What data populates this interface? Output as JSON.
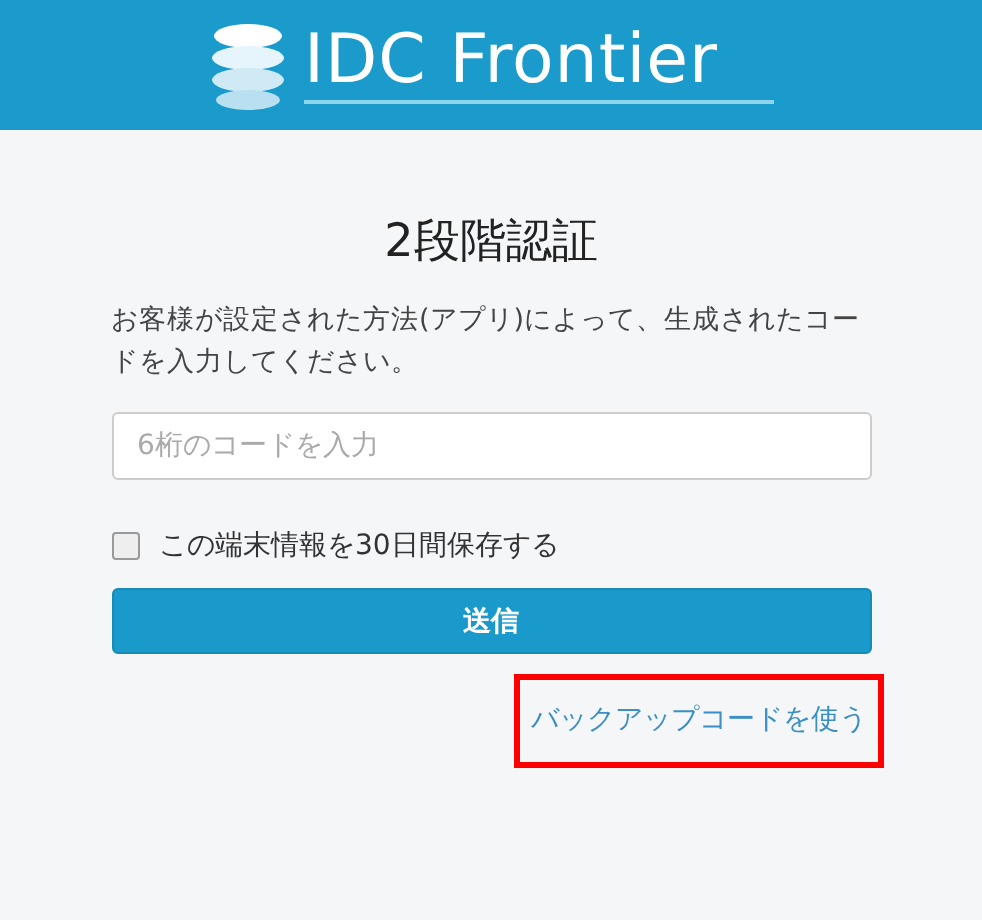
{
  "header": {
    "logo_text": "IDC Frontier"
  },
  "title": "2段階認証",
  "instructions": "お客様が設定された方法(アプリ)によって、生成されたコードを入力してください。",
  "code_field": {
    "placeholder": "6桁のコードを入力"
  },
  "remember_device": {
    "label": "この端末情報を30日間保存する",
    "checked": false
  },
  "submit_button": "送信",
  "backup_link": {
    "label": "バックアップコードを使う",
    "highlighted": true
  }
}
